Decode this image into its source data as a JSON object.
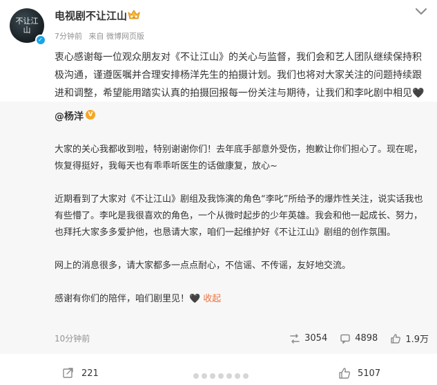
{
  "post": {
    "author": "电视剧不让江山",
    "avatar_text": "不让江山",
    "meta": {
      "time": "7分钟前",
      "source": "来自 微博网页版"
    },
    "text": "衷心感谢每一位观众朋友对《不让江山》的关心与监督，我们会和艺人团队继续保持积极沟通，谨遵医嘱并合理安排杨洋先生的拍摄计划。我们也将对大家关注的问题持续跟进和调整，希望能用踏实认真的拍摄回报每一份关注与期待，让我们和李叱剧中相见",
    "heart": "🖤"
  },
  "retweet": {
    "author": "@杨洋",
    "paragraphs": [
      "大家的关心我都收到啦，特别谢谢你们！去年底手部意外受伤，抱歉让你们担心了。现在呢，恢复得挺好，我每天也有乖乖听医生的话做康复，放心~",
      "近期看到了大家对《不让江山》剧组及我饰演的角色“李叱”所给予的爆炸性关注，说实话我也有些懵了。李叱是我很喜欢的角色，一个从微时起步的少年英雄。我会和他一起成长、努力，也拜托大家多多爱护他，也恳请大家，咱们一起维护好《不让江山》剧组的创作氛围。",
      "网上的消息很多，请大家都多一点点耐心，不信谣、不传谣，友好地交流。"
    ],
    "last_paragraph": "感谢有你们的陪伴，咱们剧里见！",
    "heart": "🖤",
    "collapse_label": "收起",
    "time": "10分钟前",
    "stats": {
      "reposts": "3054",
      "comments": "4898",
      "likes": "1.9万"
    }
  },
  "bottom": {
    "reposts": "221",
    "likes": "5107"
  },
  "colors": {
    "link": "#eb7340",
    "verified": "#1aa4e6",
    "gold_badge": "#f6a623"
  },
  "icons": [
    "verified-icon",
    "crown-icon",
    "more-icon",
    "repost-icon",
    "comment-icon",
    "like-icon"
  ]
}
